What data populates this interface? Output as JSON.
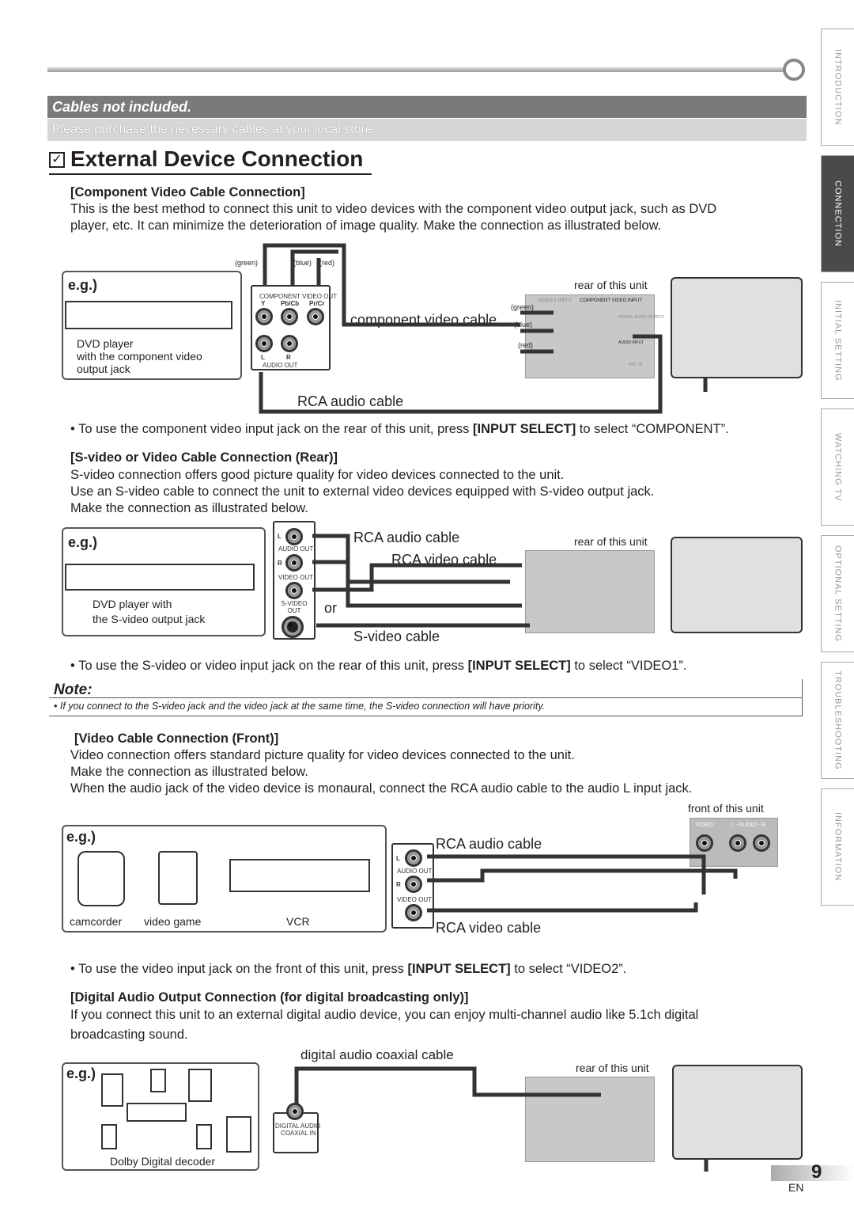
{
  "side_tabs": [
    "INTRODUCTION",
    "CONNECTION",
    "INITIAL SETTING",
    "WATCHING TV",
    "OPTIONAL SETTING",
    "TROUBLESHOOTING",
    "INFORMATION"
  ],
  "active_tab": "CONNECTION",
  "banner": {
    "title": "Cables not included.",
    "subtitle": "Please purchase the necessary cables at your local store."
  },
  "page_title": "External Device Connection",
  "title_icon": "checkbox-icon",
  "sec1": {
    "heading": "[Component Video Cable Connection]",
    "p1": "This is the best method to connect this unit to video devices with the component video output jack, such as DVD",
    "p2": "player, etc. It can minimize the deterioration of image quality. Make the connection as illustrated below.",
    "eg": "e.g.)",
    "dev1": "DVD player",
    "dev2": "with the component video",
    "dev3": "output jack",
    "green": "(green)",
    "blue": "(blue)",
    "red": "(red)",
    "panel_title": "COMPONENT VIDEO OUT",
    "y": "Y",
    "pb": "Pb/Cb",
    "pr": "Pr/Cr",
    "l": "L",
    "r": "R",
    "audio_out": "AUDIO OUT",
    "cable1": "component video cable",
    "rear": "rear of this unit",
    "cable2": "RCA audio cable",
    "rear_labels": {
      "v1": "VIDEO-1 INPUT",
      "comp": "COMPONENT VIDEO INPUT",
      "digital": "DIGITAL AUDIO OUTPUT",
      "audio": "AUDIO INPUT",
      "ant": "ANT. IN"
    },
    "bullet_pre": "• To use the component video input jack on the rear of this unit, press ",
    "bullet_key": "[INPUT SELECT]",
    "bullet_post": " to select “COMPONENT”."
  },
  "sec2": {
    "heading": "[S-video or Video Cable Connection (Rear)]",
    "p1": "S-video connection offers good picture quality for video devices connected to the unit.",
    "p2": "Use an S-video cable to connect the unit to external video devices equipped with S-video output jack.",
    "p3": "Make the connection as illustrated below.",
    "eg": "e.g.)",
    "dev1": "DVD player with",
    "dev2": "the S-video output jack",
    "l": "L",
    "audio_out": "AUDIO OUT",
    "r": "R",
    "video_out": "VIDEO OUT",
    "svideo_out": "S-VIDEO OUT",
    "cable_audio": "RCA audio cable",
    "cable_video": "RCA video cable",
    "or": "or",
    "cable_s": "S-video cable",
    "rear": "rear of this unit",
    "bullet_pre": "• To use the S-video or video input jack on the rear of this unit, press ",
    "bullet_key": "[INPUT SELECT]",
    "bullet_post": " to select “VIDEO1”."
  },
  "note": {
    "title": "Note:",
    "text": "• If you connect to the S-video jack and the video jack at the same time, the S-video connection will have priority."
  },
  "sec3": {
    "heading": "[Video Cable Connection (Front)]",
    "p1": "Video connection offers standard picture quality for video devices connected to the unit.",
    "p2": "Make the connection as illustrated below.",
    "p3": "When the audio jack of the video device is monaural, connect the RCA audio cable to the audio L input jack.",
    "front": "front of this unit",
    "front_video": "VIDEO",
    "front_audio": "L - AUDIO - R",
    "eg": "e.g.)",
    "camcorder": "camcorder",
    "game": "video game",
    "vcr": "VCR",
    "l": "L",
    "audio_out": "AUDIO OUT",
    "r": "R",
    "video_out": "VIDEO OUT",
    "cable_audio": "RCA audio cable",
    "cable_video": "RCA video cable",
    "bullet_pre": "• To use the video input jack on the front of this unit, press ",
    "bullet_key": "[INPUT SELECT]",
    "bullet_post": " to select “VIDEO2”."
  },
  "sec4": {
    "heading": "[Digital Audio Output Connection (for digital broadcasting only)]",
    "p1": "If you connect this unit to an external digital audio device, you can enjoy multi-channel audio like 5.1ch digital",
    "p2": "broadcasting sound.",
    "cable": "digital audio coaxial cable",
    "eg": "e.g.)",
    "dev": "Dolby Digital decoder",
    "jack1": "DIGITAL AUDIO",
    "jack2": "COAXIAL IN",
    "rear": "rear of this unit"
  },
  "page_number": "9",
  "lang": "EN"
}
